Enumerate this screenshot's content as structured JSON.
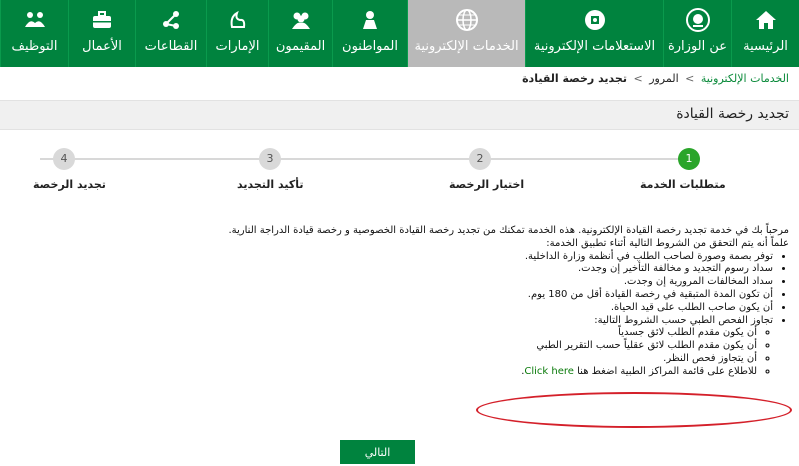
{
  "nav": {
    "items": [
      {
        "label": "الرئيسية",
        "icon": "home-icon",
        "active": false
      },
      {
        "label": "عن الوزارة",
        "icon": "ministry-emblem-icon",
        "active": false
      },
      {
        "label": "الاستعلامات الإلكترونية",
        "icon": "eservices-inquiry-icon",
        "active": false
      },
      {
        "label": "الخدمات الإلكترونية",
        "icon": "globe-icon",
        "active": true
      },
      {
        "label": "المواطنون",
        "icon": "citizen-icon",
        "active": false
      },
      {
        "label": "المقيمون",
        "icon": "residents-icon",
        "active": false
      },
      {
        "label": "الإمارات",
        "icon": "emirates-icon",
        "active": false
      },
      {
        "label": "القطاعات",
        "icon": "sectors-icon",
        "active": false
      },
      {
        "label": "الأعمال",
        "icon": "briefcase-icon",
        "active": false
      },
      {
        "label": "التوظيف",
        "icon": "employment-icon",
        "active": false
      }
    ]
  },
  "breadcrumb": {
    "items": [
      {
        "label": "الخدمات الإلكترونية",
        "link": true
      },
      {
        "label": "المرور",
        "link": false
      },
      {
        "label": "تجديد رخصة القيادة",
        "link": false,
        "current": true
      }
    ],
    "separator": ">"
  },
  "page": {
    "title": "تجديد رخصة القيادة"
  },
  "steps": [
    {
      "number": "1",
      "label": "متطلبات الخدمة",
      "active": true
    },
    {
      "number": "2",
      "label": "اختيار الرخصة",
      "active": false
    },
    {
      "number": "3",
      "label": "تأكيد التجديد",
      "active": false
    },
    {
      "number": "4",
      "label": "تجديد الرخصة",
      "active": false
    }
  ],
  "content": {
    "intro": "مرحباً بك في خدمة تجديد رخصة القيادة الإلكترونية. هذه الخدمة تمكنك من تجديد رخصة القيادة الخصوصية و رخصة قيادة الدراجة النارية.",
    "conditions_intro": "علماً أنه يتم التحقق من الشروط التالية أثناء تطبيق الخدمة:",
    "conditions": [
      "توفر بصمة وصورة لصاحب الطلب في أنظمة وزارة الداخلية.",
      "سداد رسوم التجديد و مخالفة التأخير إن وجدت.",
      "سداد المخالفات المرورية إن وجدت.",
      "أن تكون المدة المتبقية في رخصة القيادة أقل من 180 يوم.",
      "أن يكون صاحب الطلب على قيد الحياة."
    ],
    "medical_intro": "تجاوز الفحص الطبي حسب الشروط التالية:",
    "medical_conditions": [
      "أن يكون مقدم الطلب لائق جسدياً",
      "أن يكون مقدم الطلب لائق عقلياً حسب التقرير الطبي",
      "أن يتجاوز فحص النظر."
    ],
    "medical_centers_text": "للاطلاع على قائمة المراكز الطبية اضغط هنا",
    "medical_centers_link": "Click here",
    "medical_centers_suffix": "."
  },
  "actions": {
    "next_label": "التالي"
  },
  "colors": {
    "nav_bg": "#00833e",
    "nav_active_bg": "#b9b9b9",
    "step_active": "#2aa52a",
    "link": "#0a7a0a",
    "annotation": "#d4202a"
  }
}
